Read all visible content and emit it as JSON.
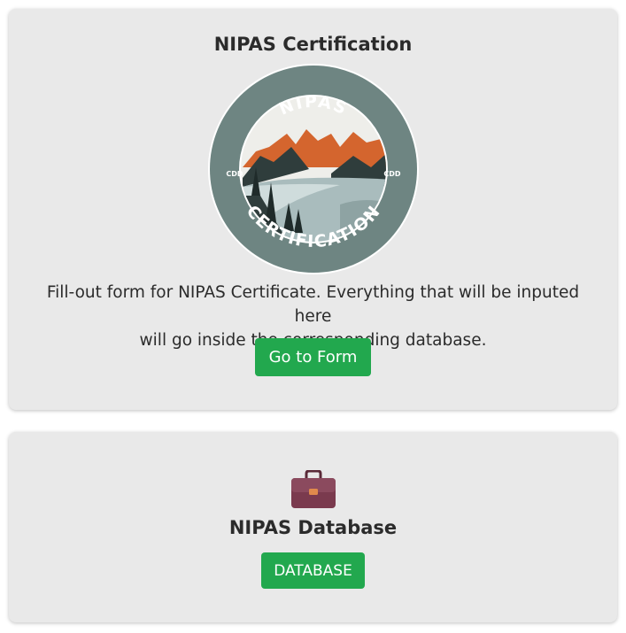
{
  "certification_card": {
    "title": "NIPAS Certification",
    "logo": {
      "top_text": "NIPAS",
      "bottom_text": "CERTIFICATION",
      "left_text": "CDD",
      "right_text": "CDD"
    },
    "description_line1": "Fill-out form for NIPAS Certificate. Everything that will be inputed here",
    "description_line2": "will go inside the corresponding database.",
    "button_label": "Go to Form"
  },
  "database_card": {
    "icon": "briefcase-icon",
    "title": "NIPAS Database",
    "button_label": "DATABASE"
  },
  "colors": {
    "button": "#22a84e",
    "card": "#e9e9e9",
    "logo_ring": "#6e8582",
    "mountain_orange": "#d4652e",
    "briefcase": "#7a3a4e"
  }
}
